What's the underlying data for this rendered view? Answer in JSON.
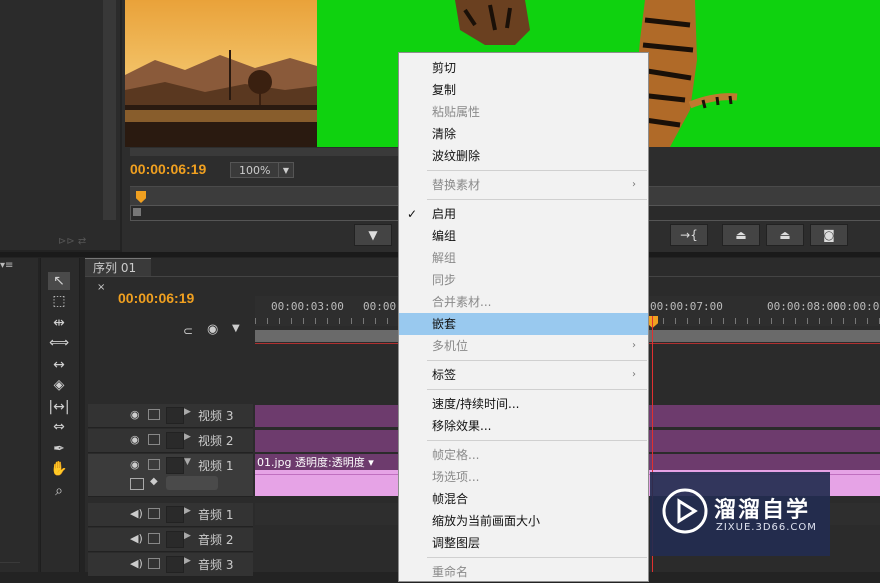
{
  "monitor": {
    "timecode": "00:00:06:19",
    "zoom": "100%",
    "buttons": [
      "▼",
      "→{",
      "⇆",
      "⇆",
      "📷"
    ]
  },
  "sequence": {
    "tab_label": "序列 01",
    "tab_close": "×",
    "timecode": "00:00:06:19",
    "ruler_labels": [
      "00:00:03:00",
      "00:00",
      "00:00:07:00",
      "00:00:08:00",
      "00:00:09"
    ],
    "tracks": [
      {
        "name": "视频 3",
        "kind": "video"
      },
      {
        "name": "视频 2",
        "kind": "video"
      },
      {
        "name": "视频 1",
        "kind": "video"
      },
      {
        "name": "音频 1",
        "kind": "audio"
      },
      {
        "name": "音频 2",
        "kind": "audio"
      },
      {
        "name": "音频 3",
        "kind": "audio"
      }
    ],
    "clip_label": "01.jpg  透明度:透明度 ▾"
  },
  "context_menu": {
    "items": [
      {
        "label": "剪切",
        "state": "enabled"
      },
      {
        "label": "复制",
        "state": "enabled"
      },
      {
        "label": "粘贴属性",
        "state": "disabled"
      },
      {
        "label": "清除",
        "state": "enabled"
      },
      {
        "label": "波纹删除",
        "state": "enabled"
      },
      {
        "label": "替换素材",
        "state": "disabled",
        "submenu": true
      },
      {
        "label": "启用",
        "state": "enabled",
        "checked": true
      },
      {
        "label": "编组",
        "state": "enabled"
      },
      {
        "label": "解组",
        "state": "disabled"
      },
      {
        "label": "同步",
        "state": "disabled"
      },
      {
        "label": "合并素材...",
        "state": "disabled"
      },
      {
        "label": "嵌套",
        "state": "highlighted"
      },
      {
        "label": "多机位",
        "state": "disabled",
        "submenu": true
      },
      {
        "label": "标签",
        "state": "enabled",
        "submenu": true
      },
      {
        "label": "速度/持续时间...",
        "state": "enabled"
      },
      {
        "label": "移除效果...",
        "state": "enabled"
      },
      {
        "label": "帧定格...",
        "state": "disabled"
      },
      {
        "label": "场选项...",
        "state": "disabled"
      },
      {
        "label": "帧混合",
        "state": "enabled"
      },
      {
        "label": "缩放为当前画面大小",
        "state": "enabled"
      },
      {
        "label": "调整图层",
        "state": "enabled"
      },
      {
        "label": "重命名",
        "state": "disabled"
      }
    ]
  },
  "watermark": {
    "title": "溜溜自学",
    "subtitle": "ZIXUE.3D66.COM"
  },
  "colors": {
    "timecode": "#f0a020",
    "greenscreen": "#0fd20f",
    "menu_highlight": "#99c9ef",
    "clip_purple": "#6d3b6d",
    "clip_pink": "#e6a3e6"
  }
}
